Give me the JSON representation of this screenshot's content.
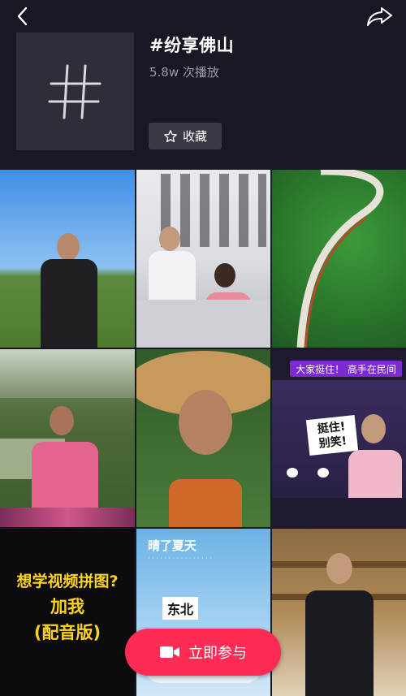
{
  "header": {
    "back_icon": "chevron-left-icon",
    "share_icon": "share-arrow-icon"
  },
  "topic": {
    "cover_icon": "hashtag-icon",
    "title": "#纷享佛山",
    "plays": "5.8w 次播放",
    "favorite_label": "收藏",
    "favorite_icon": "star-outline-icon"
  },
  "videos": [
    {
      "id": "v1",
      "overlay_lines": []
    },
    {
      "id": "v2",
      "overlay_lines": []
    },
    {
      "id": "v3",
      "overlay_lines": []
    },
    {
      "id": "v4",
      "overlay_lines": []
    },
    {
      "id": "v5",
      "overlay_lines": []
    },
    {
      "id": "v6",
      "overlay_lines": [
        "大家挺住！ 高手在民间",
        "挺住!",
        "别笑!"
      ]
    },
    {
      "id": "v7",
      "overlay_lines": [
        "想学视频拼图?",
        "加我",
        "(配音版)"
      ]
    },
    {
      "id": "v8",
      "overlay_lines": [
        "晴了夏天",
        "东北"
      ]
    },
    {
      "id": "v9",
      "overlay_lines": []
    }
  ],
  "action": {
    "join_label": "立即参与",
    "join_icon": "video-camera-icon",
    "accent": "#fe2c55"
  },
  "colors": {
    "background": "#161823",
    "cover": "#2c2e38",
    "favorite_bg": "#393b44",
    "muted_text": "#9a9ba3"
  }
}
